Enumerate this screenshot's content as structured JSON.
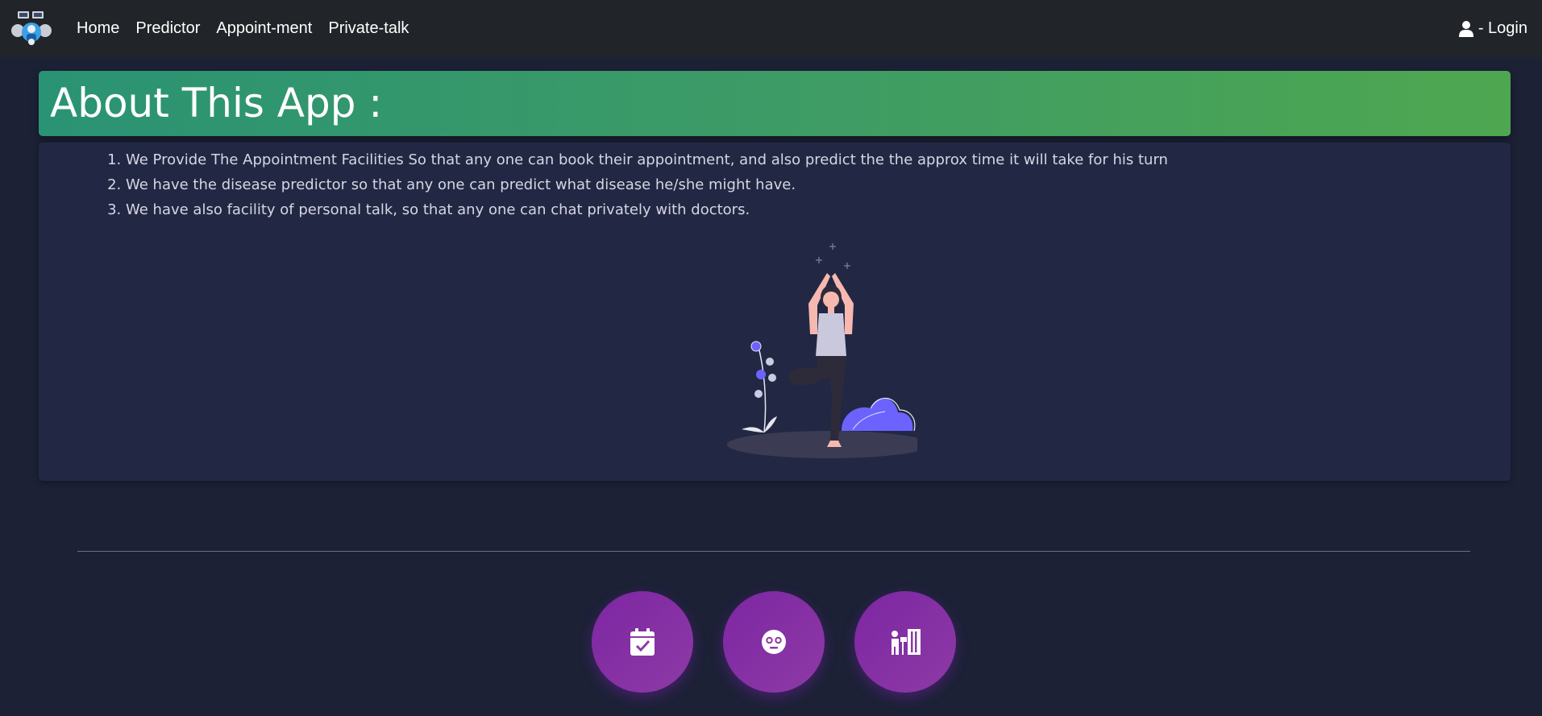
{
  "navbar": {
    "logo_icon": "doctor-robot-logo-icon",
    "links": [
      "Home",
      "Predictor",
      "Appoint-ment",
      "Private-talk"
    ],
    "login_label": "- Login",
    "login_icon": "user-icon"
  },
  "header": {
    "title": "About This App :",
    "gradient": [
      "#2a9373",
      "#4ea750"
    ]
  },
  "features": {
    "items": [
      "We Provide The Appointment Facilities So that any one can book their appointment, and also predict the the approx time it will take for his turn",
      "We have the disease predictor so that any one can predict what disease he/she might have.",
      "We have also facility of personal talk, so that any one can chat privately with doctors."
    ],
    "illustration": "yoga-woman-illustration"
  },
  "action_buttons": [
    {
      "icon": "calendar-check-icon"
    },
    {
      "icon": "face-icon"
    },
    {
      "icon": "private-room-icon"
    }
  ],
  "colors": {
    "page_bg": "#1c2136",
    "navbar_bg": "#212529",
    "card_bg": "#222844",
    "button_purple": "#8e3aa5",
    "accent_blue": "#6c63ff"
  }
}
